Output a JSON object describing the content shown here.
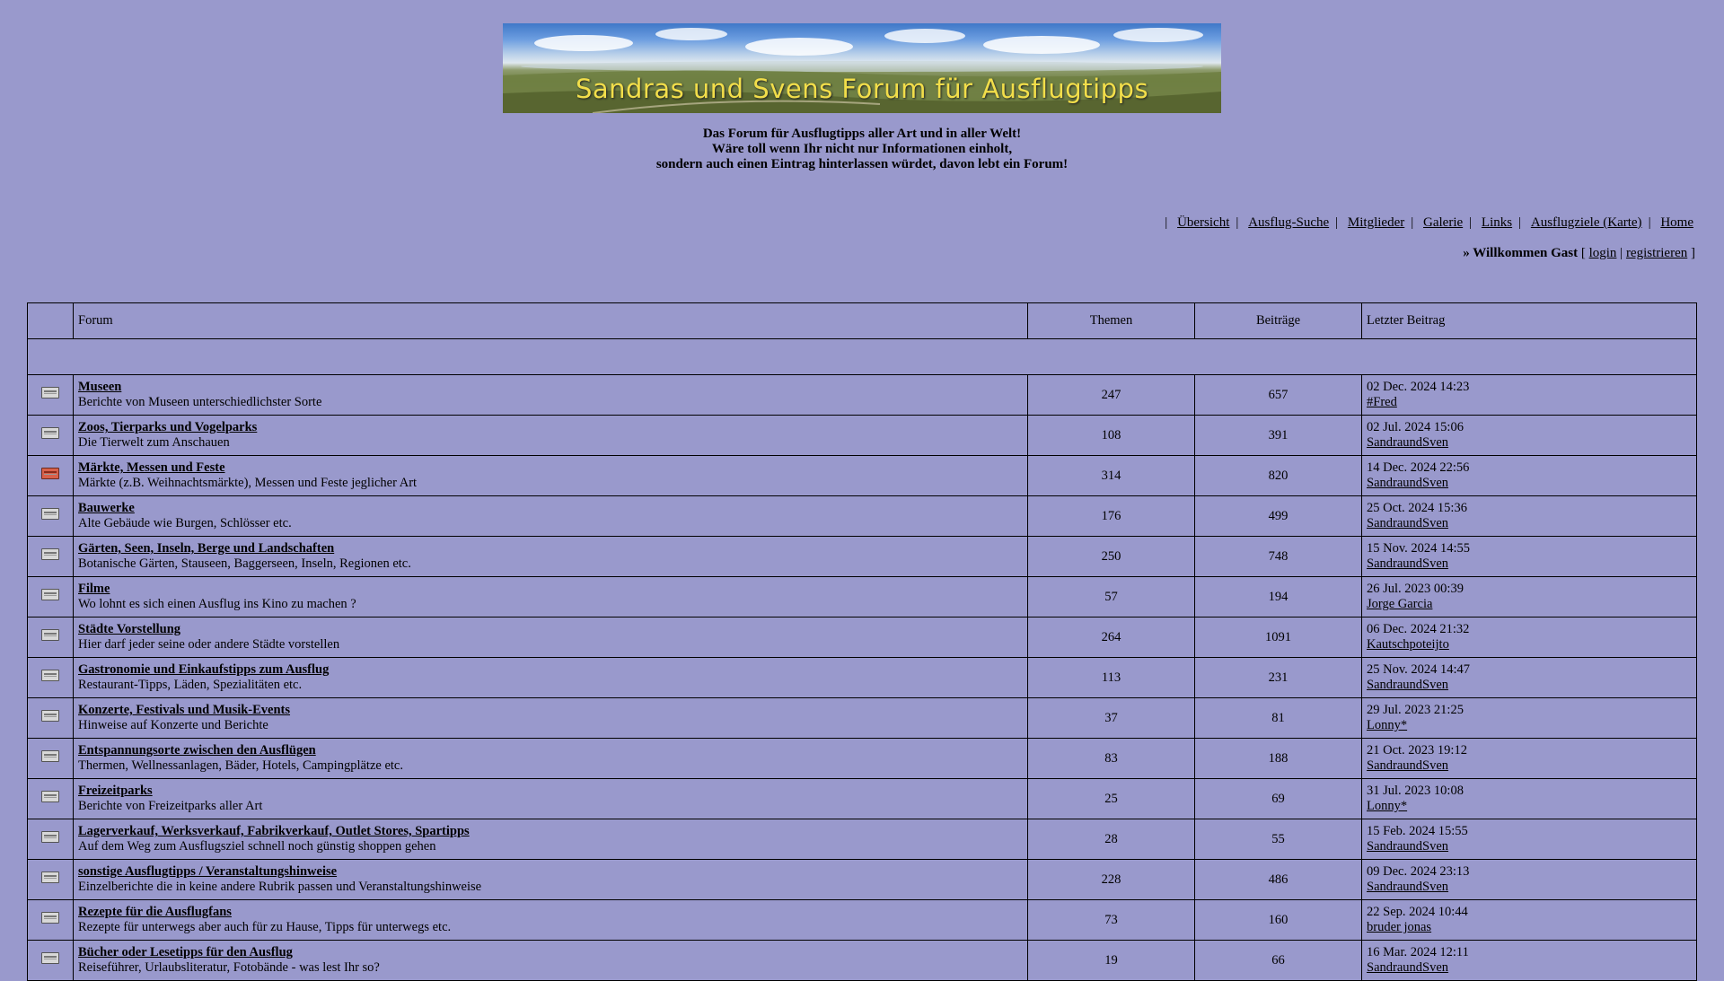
{
  "banner": {
    "title": "Sandras und Svens Forum für Ausflugtipps"
  },
  "intro": [
    "Das Forum für Ausflugtipps aller Art und in aller Welt!",
    "Wäre toll wenn Ihr nicht nur Informationen einholt,",
    "sondern auch einen Eintrag hinterlassen würdet, davon lebt ein Forum!"
  ],
  "nav": {
    "items": [
      "Übersicht",
      "Ausflug-Suche",
      "Mitglieder",
      "Galerie",
      "Links",
      "Ausflugziele (Karte)",
      "Home"
    ]
  },
  "welcome": {
    "text": "» Willkommen Gast",
    "bracket_open": "[",
    "login": "login",
    "divider": "|",
    "register": "registrieren",
    "bracket_close": "]"
  },
  "table": {
    "headers": {
      "forum": "Forum",
      "topics": "Themen",
      "posts": "Beiträge",
      "last": "Letzter Beitrag"
    },
    "rows": [
      {
        "name": "Museen",
        "desc": "Berichte von Museen unterschiedlichster Sorte",
        "topics": "247",
        "posts": "657",
        "date": "02 Dec. 2024 14:23",
        "user": "#Fred",
        "icon": "folder-icon"
      },
      {
        "name": "Zoos, Tierparks und Vogelparks",
        "desc": "Die Tierwelt zum Anschauen",
        "topics": "108",
        "posts": "391",
        "date": "02 Jul. 2024 15:06",
        "user": "SandraundSven",
        "icon": "folder-icon"
      },
      {
        "name": "Märkte, Messen und Feste",
        "desc": "Märkte (z.B. Weihnachtsmärkte), Messen und Feste jeglicher Art",
        "topics": "314",
        "posts": "820",
        "date": "14 Dec. 2024 22:56",
        "user": "SandraundSven",
        "icon": "folder-new-icon"
      },
      {
        "name": "Bauwerke",
        "desc": "Alte Gebäude wie Burgen, Schlösser etc.",
        "topics": "176",
        "posts": "499",
        "date": "25 Oct. 2024 15:36",
        "user": "SandraundSven",
        "icon": "folder-icon"
      },
      {
        "name": "Gärten, Seen, Inseln, Berge und Landschaften",
        "desc": "Botanische Gärten, Stauseen, Baggerseen, Inseln, Regionen etc.",
        "topics": "250",
        "posts": "748",
        "date": "15 Nov. 2024 14:55",
        "user": "SandraundSven",
        "icon": "folder-icon"
      },
      {
        "name": "Filme",
        "desc": "Wo lohnt es sich einen Ausflug ins Kino zu machen ?",
        "topics": "57",
        "posts": "194",
        "date": "26 Jul. 2023 00:39",
        "user": "Jorge Garcia",
        "icon": "folder-icon"
      },
      {
        "name": "Städte Vorstellung",
        "desc": "Hier darf jeder seine oder andere Städte vorstellen",
        "topics": "264",
        "posts": "1091",
        "date": "06 Dec. 2024 21:32",
        "user": "Kautschpoteijto",
        "icon": "folder-icon"
      },
      {
        "name": "Gastronomie und Einkaufstipps zum Ausflug",
        "desc": "Restaurant-Tipps, Läden, Spezialitäten etc.",
        "topics": "113",
        "posts": "231",
        "date": "25 Nov. 2024 14:47",
        "user": "SandraundSven",
        "icon": "folder-icon"
      },
      {
        "name": "Konzerte, Festivals und Musik-Events",
        "desc": "Hinweise auf Konzerte und Berichte",
        "topics": "37",
        "posts": "81",
        "date": "29 Jul. 2023 21:25",
        "user": "Lonny*",
        "icon": "folder-icon"
      },
      {
        "name": "Entspannungsorte zwischen den Ausflügen",
        "desc": "Thermen, Wellnessanlagen, Bäder, Hotels, Campingplätze etc.",
        "topics": "83",
        "posts": "188",
        "date": "21 Oct. 2023 19:12",
        "user": "SandraundSven",
        "icon": "folder-icon"
      },
      {
        "name": "Freizeitparks",
        "desc": "Berichte von Freizeitparks aller Art",
        "topics": "25",
        "posts": "69",
        "date": "31 Jul. 2023 10:08",
        "user": "Lonny*",
        "icon": "folder-icon"
      },
      {
        "name": "Lagerverkauf, Werksverkauf, Fabrikverkauf, Outlet Stores, Spartipps",
        "desc": "Auf dem Weg zum Ausflugsziel schnell noch günstig shoppen gehen",
        "topics": "28",
        "posts": "55",
        "date": "15 Feb. 2024 15:55",
        "user": "SandraundSven",
        "icon": "folder-icon"
      },
      {
        "name": "sonstige Ausflugtipps / Veranstaltungshinweise",
        "desc": "Einzelberichte die in keine andere Rubrik passen und Veranstaltungshinweise",
        "topics": "228",
        "posts": "486",
        "date": "09 Dec. 2024 23:13",
        "user": "SandraundSven",
        "icon": "folder-icon"
      },
      {
        "name": "Rezepte für die Ausflugfans",
        "desc": "Rezepte für unterwegs aber auch für zu Hause, Tipps für unterwegs etc.",
        "topics": "73",
        "posts": "160",
        "date": "22 Sep. 2024 10:44",
        "user": "bruder jonas",
        "icon": "folder-icon"
      },
      {
        "name": "Bücher oder Lesetipps für den Ausflug",
        "desc": "Reiseführer, Urlaubsliteratur, Fotobände - was lest Ihr so?",
        "topics": "19",
        "posts": "66",
        "date": "16 Mar. 2024 12:11",
        "user": "SandraundSven",
        "icon": "folder-icon"
      }
    ]
  }
}
